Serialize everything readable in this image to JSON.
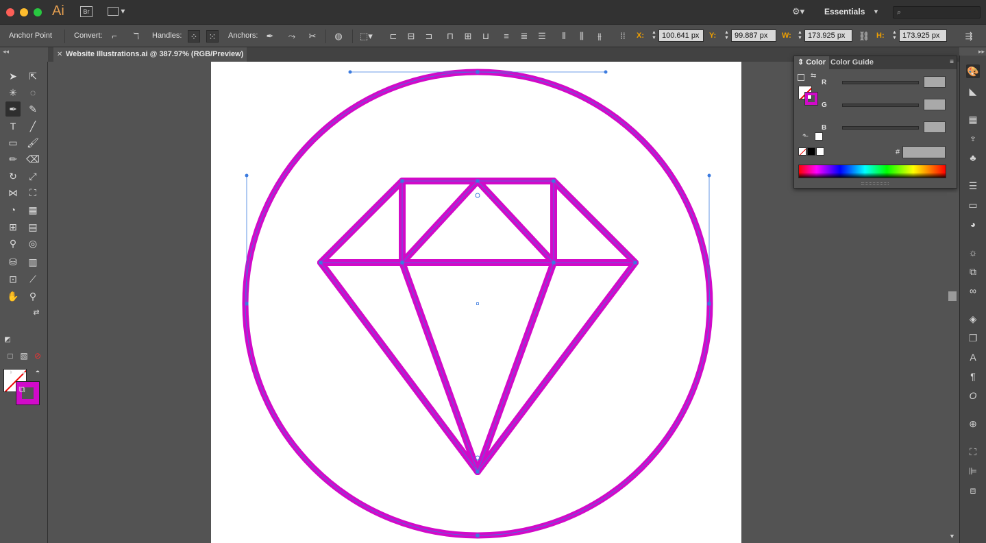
{
  "app": {
    "logo": "Ai",
    "bridge": "Br",
    "workspace": "Essentials",
    "search_placeholder": ""
  },
  "control_bar": {
    "tool_name": "Anchor Point",
    "convert_label": "Convert:",
    "handles_label": "Handles:",
    "anchors_label": "Anchors:",
    "x_label": "X:",
    "x_value": "100.641 px",
    "y_label": "Y:",
    "y_value": "99.887 px",
    "w_label": "W:",
    "w_value": "173.925 px",
    "h_label": "H:",
    "h_value": "173.925 px"
  },
  "document": {
    "tab_title": "Website Illustrations.ai @ 387.97% (RGB/Preview)",
    "stroke_color": "#d10ac9",
    "path_color": "#3b7bdf"
  },
  "color_panel": {
    "tab_active": "Color",
    "tab_inactive": "Color Guide",
    "r_label": "R",
    "g_label": "G",
    "b_label": "B",
    "hex_label": "#"
  }
}
